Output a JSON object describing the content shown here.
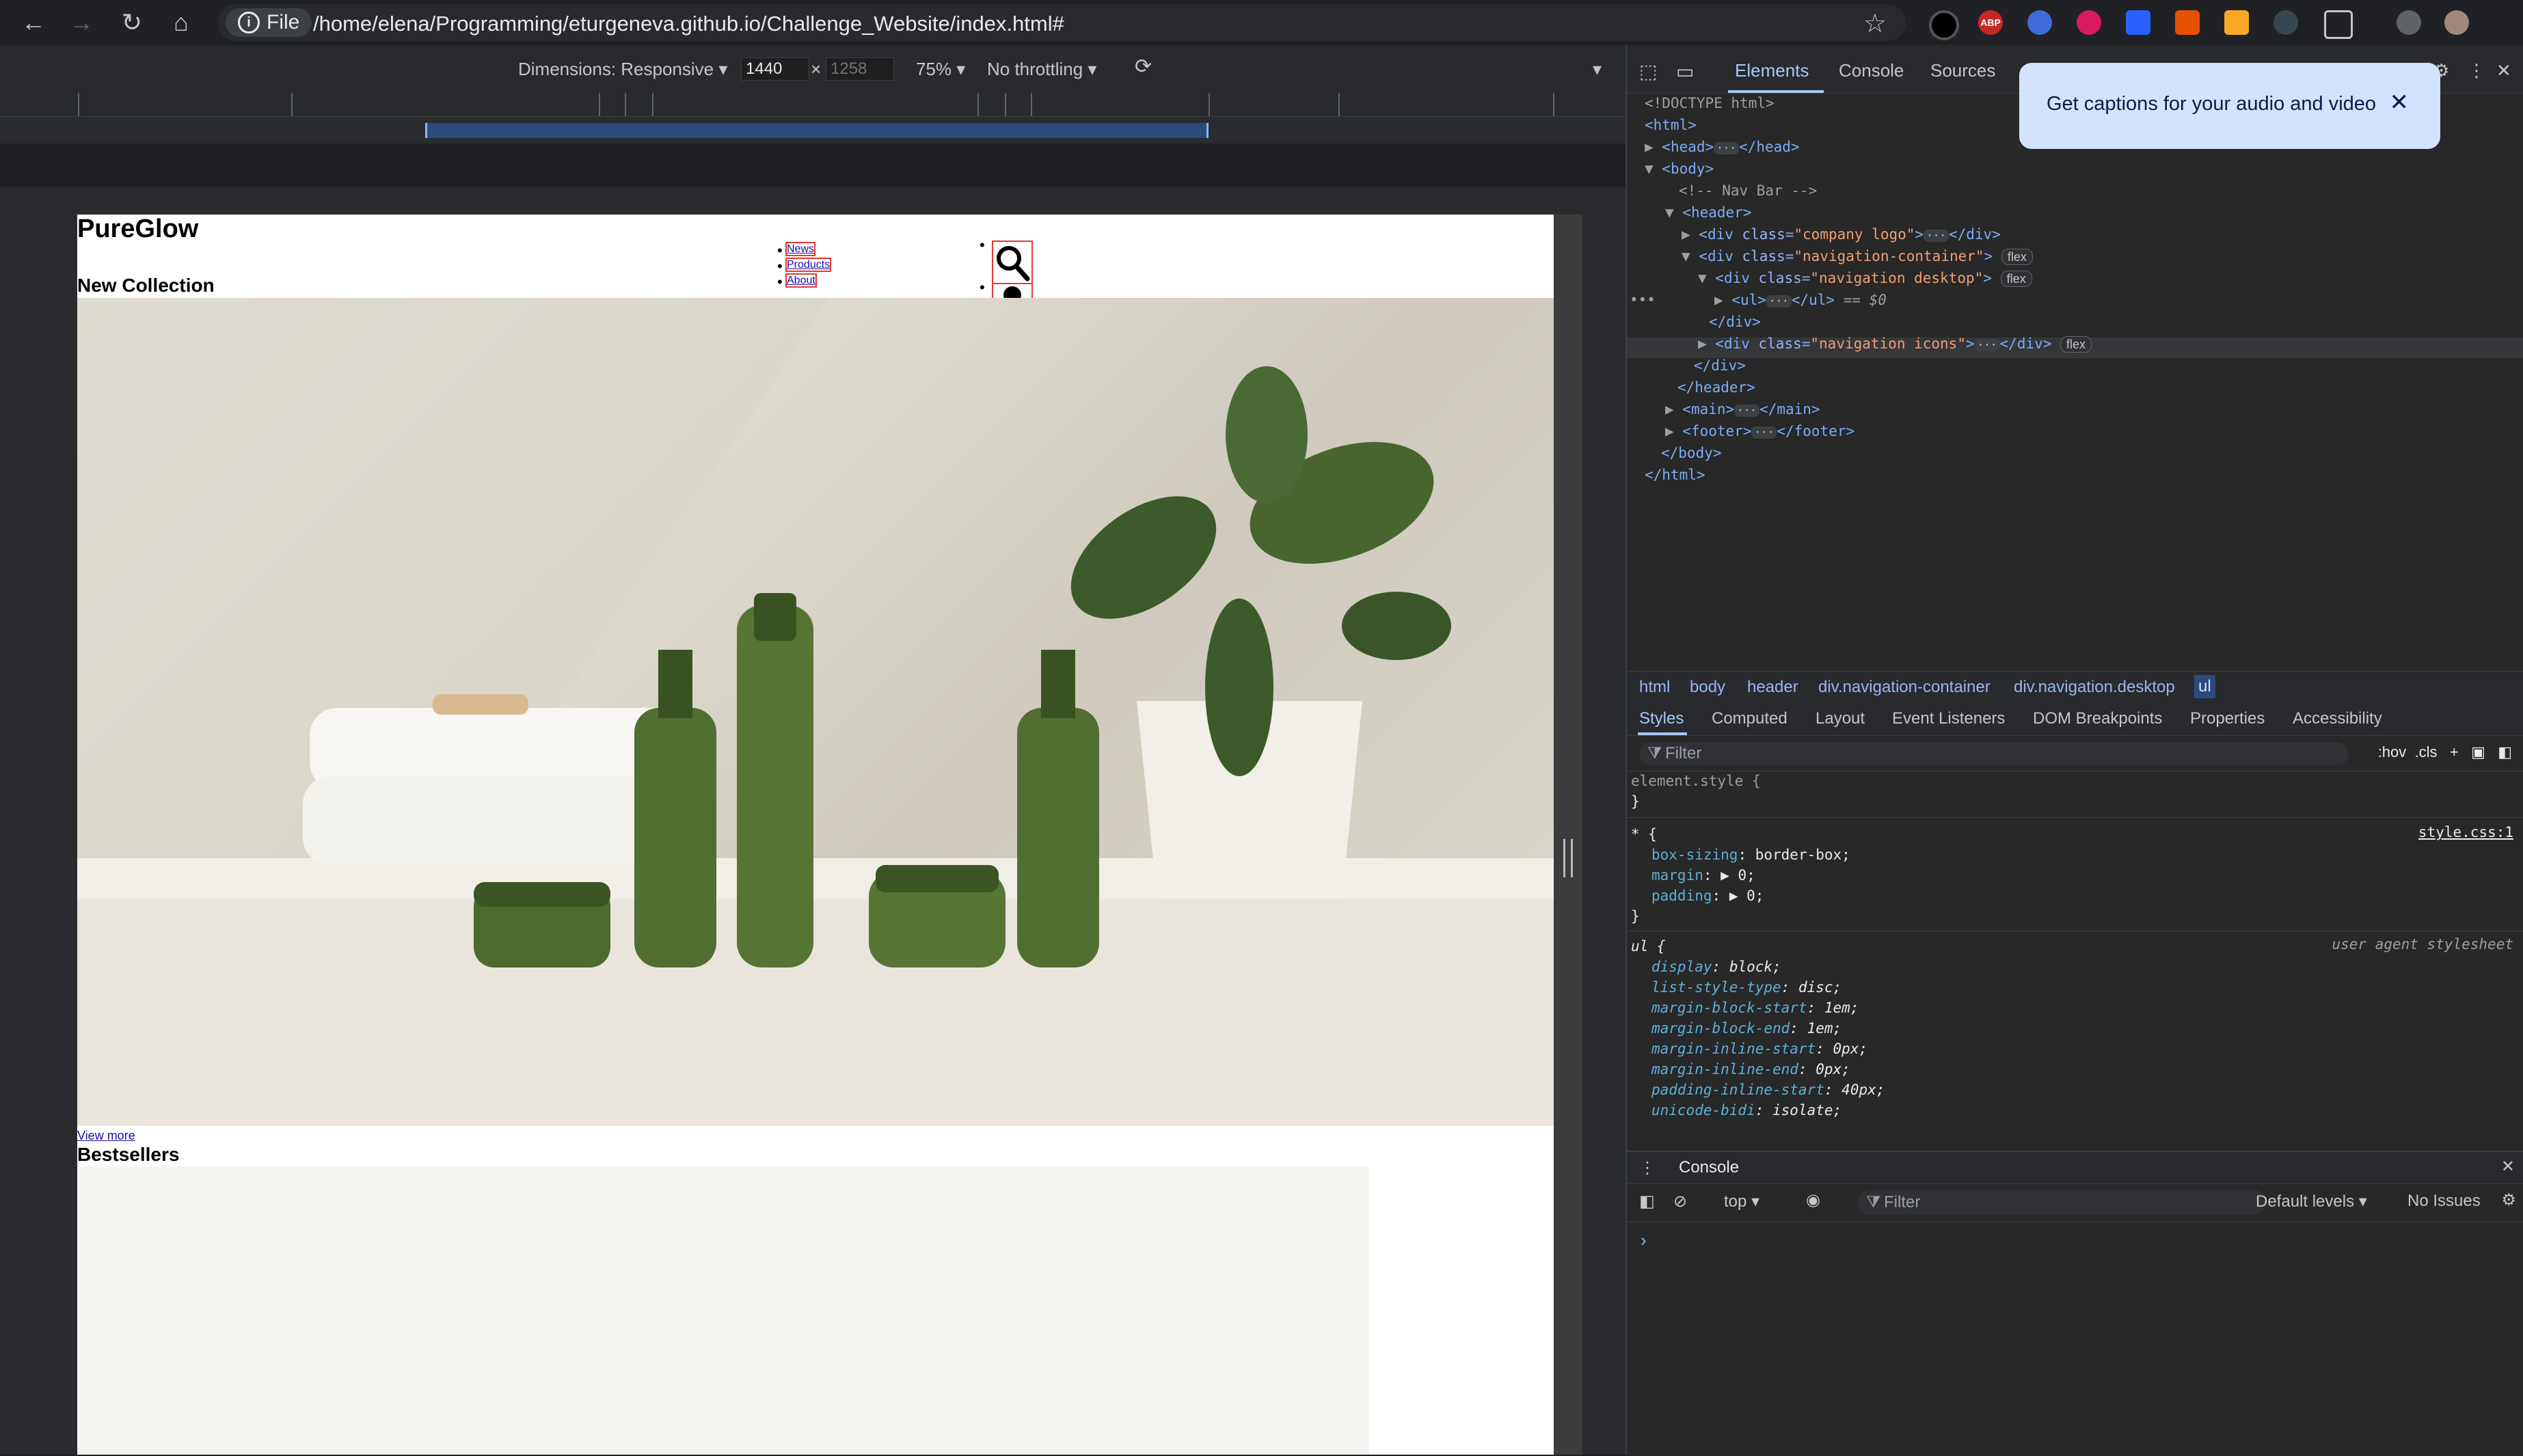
{
  "browser": {
    "file_chip": "File",
    "url": "/home/elena/Programming/eturgeneva.github.io/Challenge_Website/index.html#",
    "extensions": [
      "ABP"
    ]
  },
  "device_toolbar": {
    "dimensions_label": "Dimensions: Responsive",
    "width": "1440",
    "height": "1258",
    "zoom": "75%",
    "throttling": "No throttling"
  },
  "page": {
    "brand": "PureGlow",
    "nav_links": [
      "News",
      "Products",
      "About"
    ],
    "collection_title": "New Collection",
    "view_more": "View more",
    "bestsellers_title": "Bestsellers"
  },
  "devtools": {
    "tabs": [
      "Elements",
      "Console",
      "Sources"
    ],
    "dom": {
      "doctype": "<!DOCTYPE html>",
      "comment": "<!-- Nav Bar -->",
      "class_company_logo": "\"company logo\"",
      "class_navigation_container": "\"navigation-container\"",
      "class_navigation_desktop": "\"navigation desktop\"",
      "class_navigation_icons": "\"navigation icons\"",
      "selected_marker": "== $0",
      "badge": "flex"
    },
    "breadcrumbs": [
      "html",
      "body",
      "header",
      "div.navigation-container",
      "div.navigation.desktop",
      "ul"
    ],
    "style_tabs": [
      "Styles",
      "Computed",
      "Layout",
      "Event Listeners",
      "DOM Breakpoints",
      "Properties",
      "Accessibility"
    ],
    "filter_placeholder": "Filter",
    "filter_tools": [
      ":hov",
      ".cls"
    ],
    "styles": {
      "element_style": "element.style {",
      "universal_selector": "* {",
      "universal_source": "style.css:1",
      "universal_props": [
        {
          "name": "box-sizing",
          "value": "border-box;"
        },
        {
          "name": "margin",
          "value": "▶ 0;"
        },
        {
          "name": "padding",
          "value": "▶ 0;"
        }
      ],
      "ul_selector": "ul {",
      "ul_source": "user agent stylesheet",
      "ul_props": [
        {
          "name": "display",
          "value": "block;"
        },
        {
          "name": "list-style-type",
          "value": "disc;"
        },
        {
          "name": "margin-block-start",
          "value": "1em;"
        },
        {
          "name": "margin-block-end",
          "value": "1em;"
        },
        {
          "name": "margin-inline-start",
          "value": "0px;"
        },
        {
          "name": "margin-inline-end",
          "value": "0px;"
        },
        {
          "name": "padding-inline-start",
          "value": "40px;"
        },
        {
          "name": "unicode-bidi",
          "value": "isolate;"
        }
      ]
    },
    "console": {
      "tab": "Console",
      "context": "top",
      "filter_placeholder": "Filter",
      "levels": "Default levels",
      "issues": "No Issues"
    }
  },
  "captions_popup": {
    "text": "Get captions for your audio and video"
  },
  "colors": {
    "accent": "#a8c7fa",
    "popup_bg": "#d3e3fd",
    "highlight_outline": "#e53935"
  }
}
